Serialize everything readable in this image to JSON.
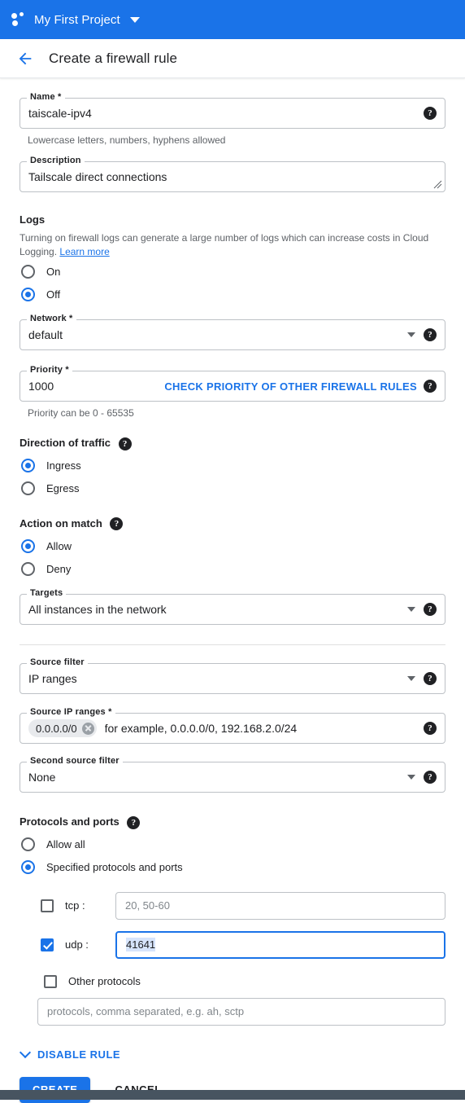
{
  "appbar": {
    "project_name": "My First Project",
    "logo_icon": "project-dots-icon",
    "caret_icon": "chevron-down-icon",
    "background_color": "#1a73e8"
  },
  "header": {
    "back_icon": "arrow-left-icon",
    "title": "Create a firewall rule"
  },
  "form": {
    "name": {
      "label": "Name *",
      "value": "taiscale-ipv4",
      "hint": "Lowercase letters, numbers, hyphens allowed",
      "help_icon": "help-icon"
    },
    "description": {
      "label": "Description",
      "value": "Tailscale direct connections",
      "resize_icon": "resize-grip-icon"
    },
    "logs": {
      "title": "Logs",
      "description_part1": "Turning on firewall logs can generate a large number of logs which can increase costs in Cloud Logging.",
      "learn_more": "Learn more",
      "options": [
        {
          "label": "On",
          "selected": false
        },
        {
          "label": "Off",
          "selected": true
        }
      ]
    },
    "network": {
      "label": "Network *",
      "value": "default",
      "dropdown_icon": "chevron-down-icon",
      "help_icon": "help-icon"
    },
    "priority": {
      "label": "Priority *",
      "value": "1000",
      "action_label": "CHECK PRIORITY OF OTHER FIREWALL RULES",
      "hint": "Priority can be 0 - 65535",
      "help_icon": "help-icon"
    },
    "direction": {
      "title": "Direction of traffic",
      "help_icon": "help-icon",
      "options": [
        {
          "label": "Ingress",
          "selected": true
        },
        {
          "label": "Egress",
          "selected": false
        }
      ]
    },
    "action_on_match": {
      "title": "Action on match",
      "help_icon": "help-icon",
      "options": [
        {
          "label": "Allow",
          "selected": true
        },
        {
          "label": "Deny",
          "selected": false
        }
      ]
    },
    "targets": {
      "label": "Targets",
      "value": "All instances in the network",
      "dropdown_icon": "chevron-down-icon",
      "help_icon": "help-icon"
    },
    "source_filter": {
      "label": "Source filter",
      "value": "IP ranges",
      "dropdown_icon": "chevron-down-icon",
      "help_icon": "help-icon"
    },
    "source_ip_ranges": {
      "label": "Source IP ranges *",
      "chip_value": "0.0.0.0/0",
      "chip_remove_icon": "close-circle-icon",
      "placeholder": "for example, 0.0.0.0/0, 192.168.2.0/24",
      "help_icon": "help-icon"
    },
    "second_source_filter": {
      "label": "Second source filter",
      "value": "None",
      "dropdown_icon": "chevron-down-icon",
      "help_icon": "help-icon"
    },
    "protocols_and_ports": {
      "title": "Protocols and ports",
      "help_icon": "help-icon",
      "options": [
        {
          "label": "Allow all",
          "selected": false
        },
        {
          "label": "Specified protocols and ports",
          "selected": true
        }
      ],
      "tcp": {
        "label": "tcp :",
        "checked": false,
        "value": "",
        "placeholder": "20, 50-60"
      },
      "udp": {
        "label": "udp :",
        "checked": true,
        "value": "41641",
        "placeholder": "",
        "focused": true
      },
      "other": {
        "label": "Other protocols",
        "checked": false,
        "value": "",
        "placeholder": "protocols, comma separated, e.g. ah, sctp"
      }
    }
  },
  "actions": {
    "disable_rule": "DISABLE RULE",
    "disable_rule_icon": "chevron-down-icon",
    "create": "CREATE",
    "cancel": "CANCEL"
  }
}
